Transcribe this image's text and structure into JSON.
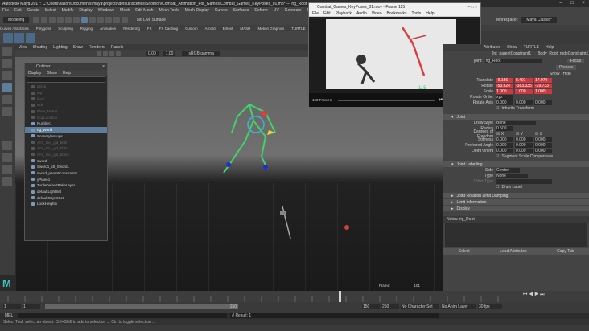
{
  "window": {
    "title": "Autodesk Maya 2017: C:\\Users\\Jason\\Documents\\maya\\projects\\default\\scenes\\Snomon\\Combat_Animation_For_Games\\Combat_Games_KeyPoses_01.mb* --- rig_Root"
  },
  "menubar": [
    "File",
    "Edit",
    "Create",
    "Select",
    "Modify",
    "Display",
    "Windows",
    "Mesh",
    "Edit Mesh",
    "Mesh Tools",
    "Mesh Display",
    "Curves",
    "Surfaces",
    "Deform",
    "UV",
    "Generate",
    "Cache",
    "Help"
  ],
  "shelf": {
    "mode": "Modeling",
    "live_surface": "No Live Surface",
    "workspace_label": "Workspace :",
    "workspace_value": "Maya Classic*"
  },
  "shelf_tabs": [
    "Curves / Surfaces",
    "Polygons",
    "Sculpting",
    "Rigging",
    "Animation",
    "Rendering",
    "FX",
    "FX Caching",
    "Custom",
    "Arnold",
    "Bifrost",
    "MASH",
    "Motion Graphics",
    "TURTLE",
    "XGen"
  ],
  "viewport": {
    "menu": [
      "View",
      "Shading",
      "Lighting",
      "Show",
      "Renderer",
      "Panels"
    ],
    "near": "0.00",
    "far": "1.00",
    "gamma": "sRGB gamma",
    "frame_label": "Frame:",
    "frame_value": "101"
  },
  "outliner": {
    "title": "Outliner",
    "menu": [
      "Display",
      "Show",
      "Help"
    ],
    "items": [
      {
        "label": "persp",
        "dim": true
      },
      {
        "label": "top",
        "dim": true
      },
      {
        "label": "front",
        "dim": true
      },
      {
        "label": "side",
        "dim": true
      },
      {
        "label": "Floor_Matter",
        "dim": true
      },
      {
        "label": "CopLocation",
        "dim": true
      },
      {
        "label": "Number1",
        "dim": false
      },
      {
        "label": "rig_World",
        "dim": false,
        "selected": true
      },
      {
        "label": "Scenerylessups",
        "dim": false
      },
      {
        "label": "Arm_Gid_gid_bbrk",
        "dim": true
      },
      {
        "label": "Arm_Gid_gid_bbrk1",
        "dim": true
      },
      {
        "label": "Arm_Gid_gid_bbrk2",
        "dim": true
      },
      {
        "label": "sword",
        "dim": false
      },
      {
        "label": "Sword1_ctl_Sword1",
        "dim": false
      },
      {
        "label": "sword_parentConstraint1",
        "dim": false
      },
      {
        "label": "yPlane1",
        "dim": false
      },
      {
        "label": "TurtleDefaultBakeLayer",
        "dim": false
      },
      {
        "label": "defaultLightSet",
        "dim": false
      },
      {
        "label": "defaultObjectSet",
        "dim": false
      },
      {
        "label": "LookHeights",
        "dim": false
      }
    ]
  },
  "player": {
    "title": "Combat_Games_KeyPoses_01.mov - Frame 115",
    "menu": [
      "File",
      "Edit",
      "Playback",
      "Audio",
      "Video",
      "Bookmarks",
      "Tools",
      "Help"
    ],
    "frames_label": "150 Frames",
    "frame": "115"
  },
  "attr": {
    "tabs": [
      "Attributes",
      "Show",
      "TURTLE",
      "Help"
    ],
    "node_a": "Jnt_parentConstraint1",
    "node_b": "Body_Root_rodeConstraint1",
    "root_label": "joint:",
    "root_value": "rig_Root",
    "focus": "Focus",
    "presets": "Presets",
    "show": "Show",
    "hide": "Hide",
    "translate_label": "Translate",
    "rotate_label": "Rotate",
    "scale_label": "Scale",
    "translate": [
      "-9.156",
      "8.491",
      "17.970"
    ],
    "rotate": [
      "-53.624",
      "-383.335",
      "-29.733"
    ],
    "scale": [
      "1.000",
      "1.000",
      "1.000"
    ],
    "rotate_order_label": "Rotate Order",
    "rotate_order": "xyz",
    "rotate_axis_label": "Rotate Axis",
    "rotate_axis": [
      "0.000",
      "0.000",
      "0.000"
    ],
    "inherits": "Inherits Transform",
    "joint_section": "Joint",
    "draw_style_label": "Draw Style",
    "draw_style": "Bone",
    "radius_label": "Radius",
    "radius": "0.500",
    "dof_label": "Degrees of Freedom",
    "dof": [
      "X",
      "Y",
      "Z"
    ],
    "stiffness_label": "Stiffness",
    "stiffness": [
      "0.000",
      "0.000",
      "0.000"
    ],
    "pref_label": "Preferred Angle",
    "pref": [
      "0.000",
      "0.000",
      "0.000"
    ],
    "orient_label": "Joint Orient",
    "orient": [
      "0.000",
      "0.000",
      "0.000"
    ],
    "segment": "Segment Scale Compensate",
    "labelling_section": "Joint Labelling",
    "side_label": "Side",
    "side": "Center",
    "type_label": "Type",
    "type": "None",
    "other_label": "Other Type",
    "draw_label": "Draw Label",
    "sec_rot": "Joint Rotation Limit Damping",
    "sec_info": "Limit Information",
    "sec_disp": "Display",
    "notes": "Notes: rig_Root",
    "select": "Select",
    "load": "Load Attributes",
    "copy": "Copy Tab"
  },
  "timeline": {
    "start": "1",
    "start2": "1",
    "range_end": "150",
    "end1": "150",
    "end2": "250",
    "char_set": "No Character Set",
    "anim_layer": "No Anim Layer",
    "fps": "30 fps"
  },
  "cmd": {
    "lang": "MEL",
    "result": "// Result: 1"
  },
  "help_line": "Select Tool: select an object. Ctrl+Shift to add to selection ... Ctrl to toggle selection ..."
}
